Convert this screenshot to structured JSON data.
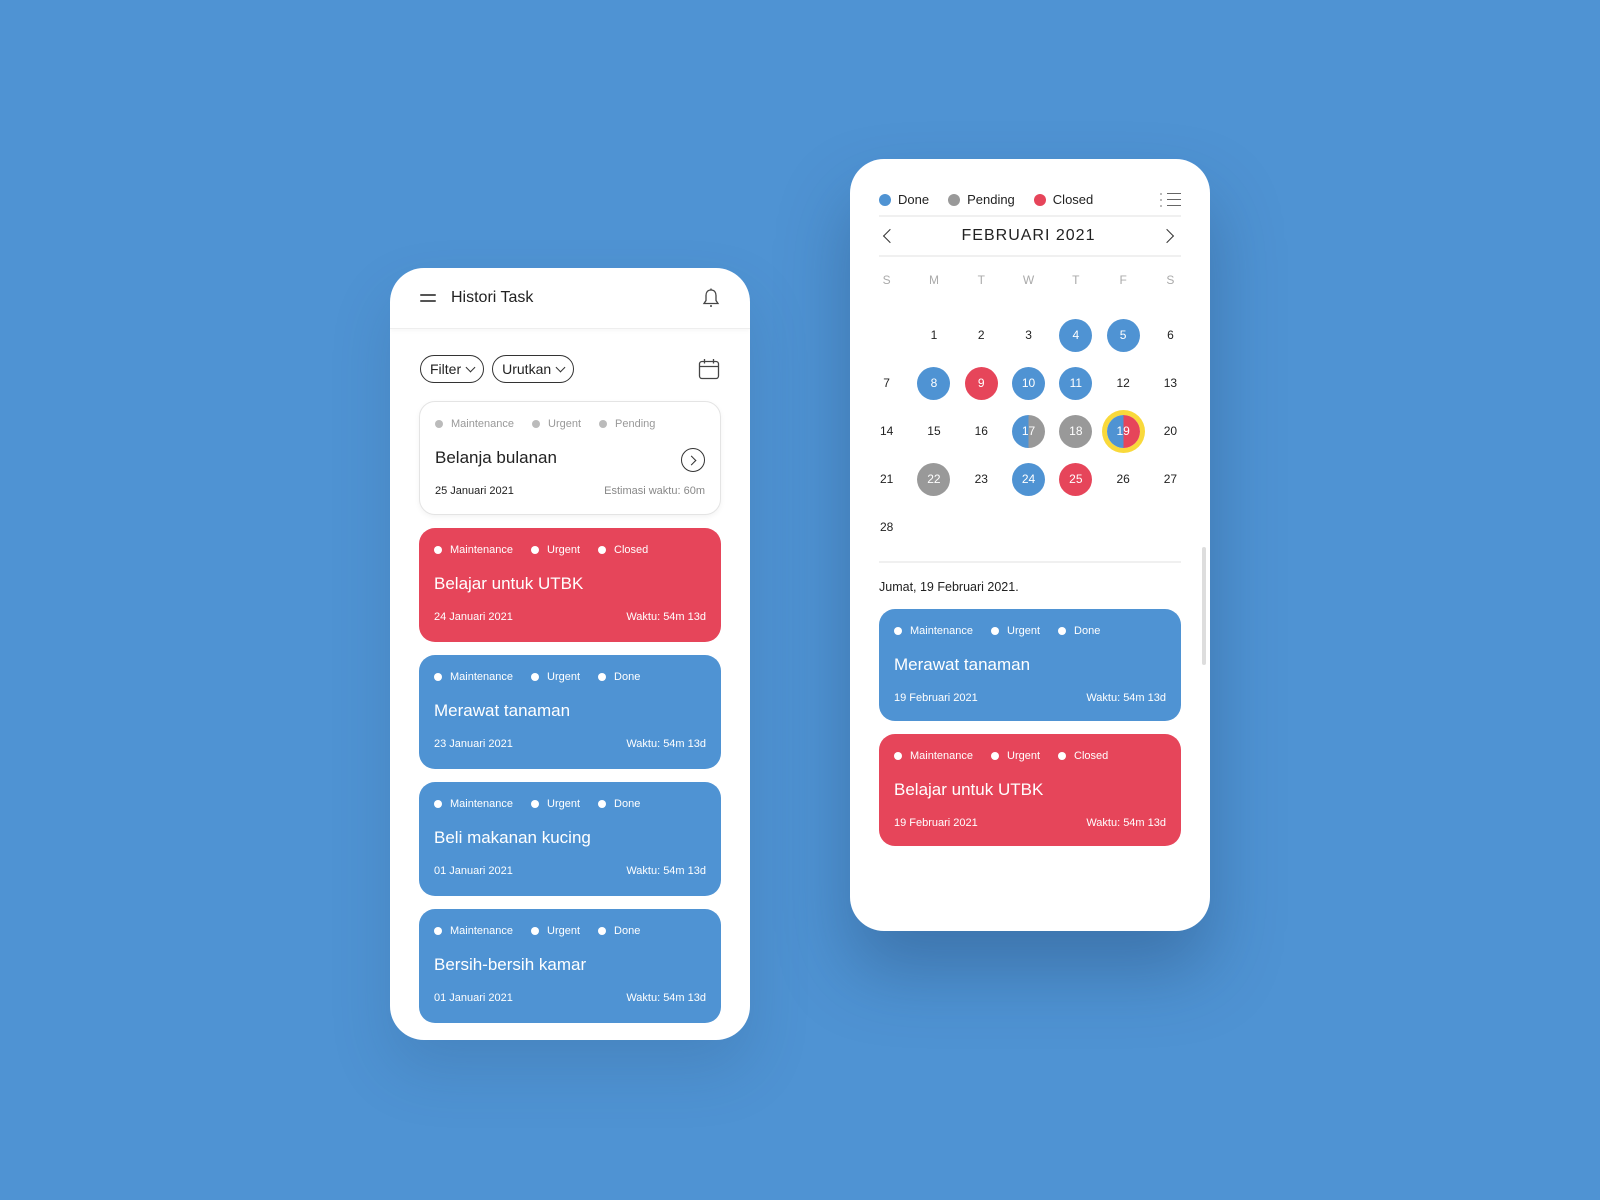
{
  "colors": {
    "background": "#4f93d3",
    "done": "#4f93d3",
    "pending": "#999999",
    "closed": "#e6455a",
    "selected_ring": "#f9d93b"
  },
  "history": {
    "header": {
      "title": "Histori Task",
      "menu_icon": "hamburger-icon",
      "notification_icon": "bell-icon"
    },
    "filters": {
      "filter_label": "Filter",
      "sort_label": "Urutkan",
      "calendar_icon": "calendar-icon"
    },
    "tasks": [
      {
        "tags": [
          "Maintenance",
          "Urgent",
          "Pending"
        ],
        "title": "Belanja bulanan",
        "date": "25 Januari 2021",
        "time": "Estimasi waktu: 60m",
        "status": "pending"
      },
      {
        "tags": [
          "Maintenance",
          "Urgent",
          "Closed"
        ],
        "title": "Belajar untuk UTBK",
        "date": "24 Januari 2021",
        "time": "Waktu: 54m 13d",
        "status": "closed"
      },
      {
        "tags": [
          "Maintenance",
          "Urgent",
          "Done"
        ],
        "title": "Merawat tanaman",
        "date": "23 Januari 2021",
        "time": "Waktu: 54m 13d",
        "status": "done"
      },
      {
        "tags": [
          "Maintenance",
          "Urgent",
          "Done"
        ],
        "title": "Beli makanan kucing",
        "date": "01 Januari 2021",
        "time": "Waktu: 54m 13d",
        "status": "done"
      },
      {
        "tags": [
          "Maintenance",
          "Urgent",
          "Done"
        ],
        "title": "Bersih-bersih kamar",
        "date": "01 Januari 2021",
        "time": "Waktu: 54m 13d",
        "status": "done"
      }
    ]
  },
  "calendar": {
    "legend": [
      {
        "label": "Done",
        "status": "done"
      },
      {
        "label": "Pending",
        "status": "pending"
      },
      {
        "label": "Closed",
        "status": "closed"
      }
    ],
    "month_title": "FEBRUARI 2021",
    "weekdays": [
      "S",
      "M",
      "T",
      "W",
      "T",
      "F",
      "S"
    ],
    "leading_blank_days": 1,
    "days": [
      {
        "d": "1"
      },
      {
        "d": "2"
      },
      {
        "d": "3"
      },
      {
        "d": "4",
        "s": "done"
      },
      {
        "d": "5",
        "s": "done"
      },
      {
        "d": "6"
      },
      {
        "d": "7"
      },
      {
        "d": "8",
        "s": "done"
      },
      {
        "d": "9",
        "s": "closed"
      },
      {
        "d": "10",
        "s": "done"
      },
      {
        "d": "11",
        "s": "done"
      },
      {
        "d": "12"
      },
      {
        "d": "13"
      },
      {
        "d": "14"
      },
      {
        "d": "15"
      },
      {
        "d": "16"
      },
      {
        "d": "17",
        "s": "split-dp"
      },
      {
        "d": "18",
        "s": "pending"
      },
      {
        "d": "19",
        "s": "split-dc",
        "selected": true
      },
      {
        "d": "20"
      },
      {
        "d": "21"
      },
      {
        "d": "22",
        "s": "pending"
      },
      {
        "d": "23"
      },
      {
        "d": "24",
        "s": "done"
      },
      {
        "d": "25",
        "s": "closed"
      },
      {
        "d": "26"
      },
      {
        "d": "27"
      },
      {
        "d": "28"
      }
    ],
    "selected_date_label": "Jumat, 19 Februari 2021.",
    "tasks": [
      {
        "tags": [
          "Maintenance",
          "Urgent",
          "Done"
        ],
        "title": "Merawat tanaman",
        "date": "19 Februari 2021",
        "time": "Waktu: 54m 13d",
        "status": "done"
      },
      {
        "tags": [
          "Maintenance",
          "Urgent",
          "Closed"
        ],
        "title": "Belajar untuk UTBK",
        "date": "19 Februari 2021",
        "time": "Waktu: 54m 13d",
        "status": "closed"
      }
    ]
  }
}
